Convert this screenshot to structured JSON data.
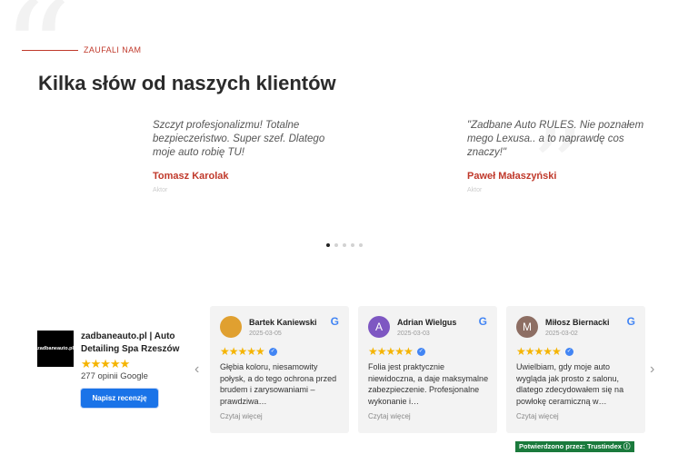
{
  "section": {
    "eyebrow": "ZAUFALI NAM",
    "heading": "Kilka słów od naszych klientów"
  },
  "testimonials": [
    {
      "quote": "Szczyt profesjonalizmu! Totalne bezpieczeństwo. Super szef. Dlatego moje auto robię TU!",
      "author": "Tomasz Karolak",
      "role": "Aktor"
    },
    {
      "quote": "\"Zadbane Auto RULES. Nie poznałem mego Lexusa.. a to naprawdę cos znaczy!\"",
      "author": "Paweł Małaszyński",
      "role": "Aktor"
    }
  ],
  "carousel": {
    "dots": 5,
    "active": 0
  },
  "company": {
    "logo_text": "zadbaneauto.pl",
    "name": "zadbaneauto.pl | Auto Detailing Spa Rzeszów",
    "rating": 4.5,
    "stars": "★★★★★",
    "reviews_count": "277 opinii Google",
    "write_review": "Napisz recenzję"
  },
  "reviews": [
    {
      "name": "Bartek Kaniewski",
      "date": "2025-03-05",
      "avatar": "",
      "avatar_color": "#e0a030",
      "stars": "★★★★★",
      "text": "Głębia koloru, niesamowity połysk, a do tego ochrona przed brudem i zarysowaniami – prawdziwa…",
      "more": "Czytaj więcej"
    },
    {
      "name": "Adrian Wielgus",
      "date": "2025-03-03",
      "avatar": "A",
      "avatar_color": "#7e57c2",
      "stars": "★★★★★",
      "text": "Folia jest praktycznie niewidoczna, a daje maksymalne zabezpieczenie. Profesjonalne wykonanie i…",
      "more": "Czytaj więcej"
    },
    {
      "name": "Miłosz Biernacki",
      "date": "2025-03-02",
      "avatar": "M",
      "avatar_color": "#8d6e63",
      "stars": "★★★★★",
      "text": "Uwielbiam, gdy moje auto wygląda jak prosto z salonu, dlatego zdecydowałem się na powłokę ceramiczną w…",
      "more": "Czytaj więcej"
    }
  ],
  "icons": {
    "google": "G",
    "verified": "✓",
    "arrow_left": "‹",
    "arrow_right": "›"
  },
  "trust_badge": "Potwierdzono przez: Trustindex ⓘ",
  "colors": {
    "accent": "#c0392b",
    "button": "#1a73e8",
    "star": "#f5b400",
    "trust": "#1a7a3c"
  }
}
